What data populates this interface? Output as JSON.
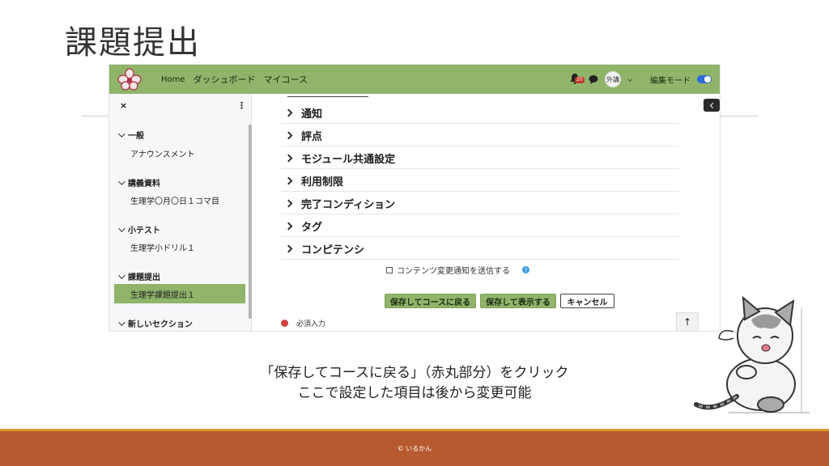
{
  "slide": {
    "title": "課題提出",
    "caption_line1": "「保存してコースに戻る」（赤丸部分）をクリック",
    "caption_line2": "ここで設定した項目は後から変更可能",
    "footer": "© いるかん"
  },
  "navbar": {
    "links": [
      "Home",
      "ダッシュボード",
      "マイコース"
    ],
    "notification_count": "20",
    "avatar_text": "外講",
    "edit_mode_label": "編集モード"
  },
  "sidebar": {
    "close_label": "×",
    "more_label": "⋮",
    "sections": [
      {
        "title": "一般",
        "items": [
          "アナウンスメント"
        ]
      },
      {
        "title": "講義資料",
        "items": [
          "生理学〇月〇日１コマ目"
        ]
      },
      {
        "title": "小テスト",
        "items": [
          "生理学小ドリル１"
        ]
      },
      {
        "title": "課題提出",
        "items": [
          "生理学課題提出１"
        ]
      },
      {
        "title": "新しいセクション",
        "items": []
      }
    ]
  },
  "main": {
    "accordion": [
      "通知",
      "評点",
      "モジュール共通設定",
      "利用制限",
      "完了コンディション",
      "タグ",
      "コンピテンシ"
    ],
    "checkbox_label": "コンテンツ変更通知を送信する",
    "help_label": "?",
    "buttons": {
      "save_return": "保存してコースに戻る",
      "save_display": "保存して表示する",
      "cancel": "キャンセル"
    },
    "required_label": "必須入力",
    "up_label": "↑"
  }
}
